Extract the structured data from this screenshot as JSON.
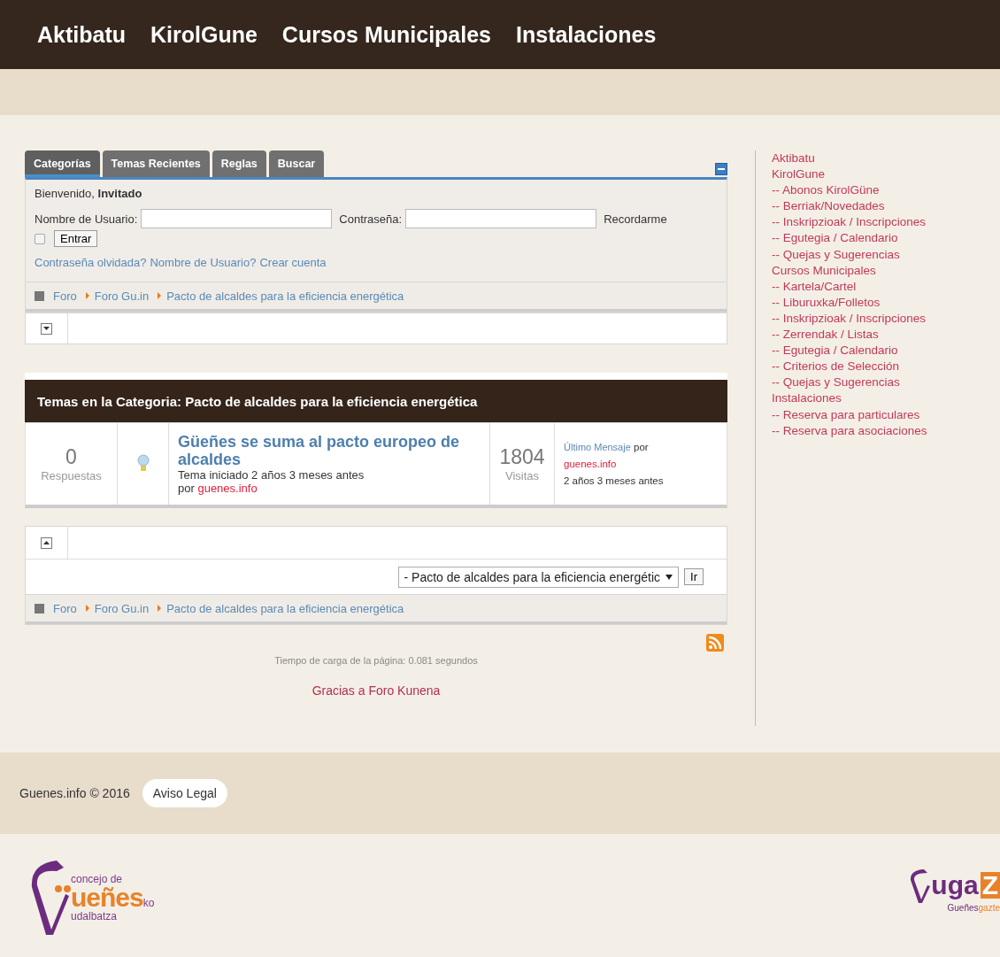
{
  "nav": [
    "Aktibatu",
    "KirolGune",
    "Cursos Municipales",
    "Instalaciones"
  ],
  "tabs": [
    {
      "label": "Categorías",
      "selected": true
    },
    {
      "label": "Temas Recientes",
      "selected": false
    },
    {
      "label": "Reglas",
      "selected": false
    },
    {
      "label": "Buscar",
      "selected": false
    }
  ],
  "login": {
    "welcome": "Bienvenido, **Invitado**",
    "username_label": "Nombre de Usuario:",
    "password_label": "Contraseña:",
    "remember_label": "Recordarme",
    "remember_checked": false,
    "submit": "Entrar",
    "links": [
      "Contraseña olvidada?",
      "Nombre de Usuario?",
      "Crear cuenta"
    ]
  },
  "breadcrumbs_top": [
    "Foro",
    "Foro Gu.in",
    "Pacto de alcaldes para la eficiencia energética"
  ],
  "category": {
    "title": "Temas en la Categoria: Pacto de alcaldes para la eficiencia energética",
    "topics": [
      {
        "replies": "0",
        "replies_label": "Respuestas",
        "title": "Güeñes se suma al pacto europeo de alcaldes",
        "started": "Tema iniciado 2 años 3 meses antes",
        "by": "por",
        "author": "guenes.info",
        "views": "1804",
        "views_label": "Visitas",
        "last_label": "Último Mensaje",
        "last_by": "por",
        "last_author": "guenes.info",
        "last_time": "2 años 3 meses antes"
      }
    ]
  },
  "jump": {
    "value": "- Pacto de alcaldes para la eficiencia energétic",
    "button": "Ir"
  },
  "breadcrumbs_bottom": [
    "Foro",
    "Foro Gu.in",
    "Pacto de alcaldes para la eficiencia energética"
  ],
  "load_time": "Tiempo de carga de la página: 0.081 segundos",
  "credits": "Gracias a Foro Kunena",
  "sidebar": {
    "items": [
      {
        "label": "Aktibatu"
      },
      {
        "label": "KirolGune",
        "children": [
          {
            "label": "-- Abonos KirolGüne"
          },
          {
            "label": "-- Berriak/Novedades"
          },
          {
            "label": "-- Inskripzioak / Inscripciones"
          },
          {
            "label": "-- Egutegia / Calendario"
          },
          {
            "label": "-- Quejas y Sugerencias"
          }
        ]
      },
      {
        "label": "Cursos Municipales",
        "children": [
          {
            "label": "-- Kartela/Cartel"
          },
          {
            "label": "-- Liburuxka/Folletos"
          },
          {
            "label": "-- Inskripzioak / Inscripciones"
          },
          {
            "label": "-- Zerrendak / Listas"
          },
          {
            "label": "-- Egutegia / Calendario"
          },
          {
            "label": "-- Criterios de Selección"
          },
          {
            "label": "-- Quejas y Sugerencias"
          }
        ]
      },
      {
        "label": "Instalaciones",
        "children": [
          {
            "label": "-- Reserva para particulares"
          },
          {
            "label": "-- Reserva para asociaciones"
          }
        ]
      }
    ]
  },
  "footer": {
    "copyright": "Guenes.info © 2016",
    "legal": "Aviso Legal"
  },
  "logos": {
    "left": {
      "top": "concejo de",
      "main": "ueñes",
      "suffix": "ko",
      "bottom": "udalbatza"
    },
    "right": {
      "main": "uga",
      "box": "Z",
      "sub_a": "Gueñes",
      "sub_b": "gazte"
    }
  }
}
